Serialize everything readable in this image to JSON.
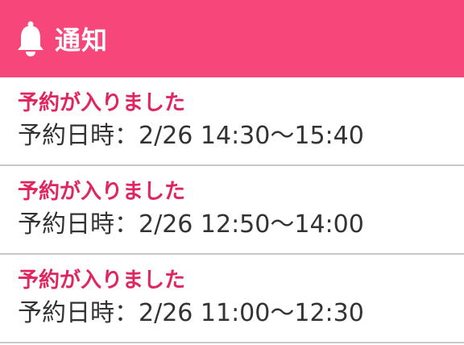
{
  "header": {
    "icon": "bell-icon",
    "title": "通知",
    "background_color": "#f6467a"
  },
  "notifications": [
    {
      "title": "予約が入りました",
      "detail": "予約日時：2/26 14:30〜15:40"
    },
    {
      "title": "予約が入りました",
      "detail": "予約日時：2/26 12:50〜14:00"
    },
    {
      "title": "予約が入りました",
      "detail": "予約日時：2/26 11:00〜12:30"
    }
  ],
  "colors": {
    "title_text": "#e0255f",
    "detail_text": "#333333",
    "divider": "#c9c9c9"
  }
}
